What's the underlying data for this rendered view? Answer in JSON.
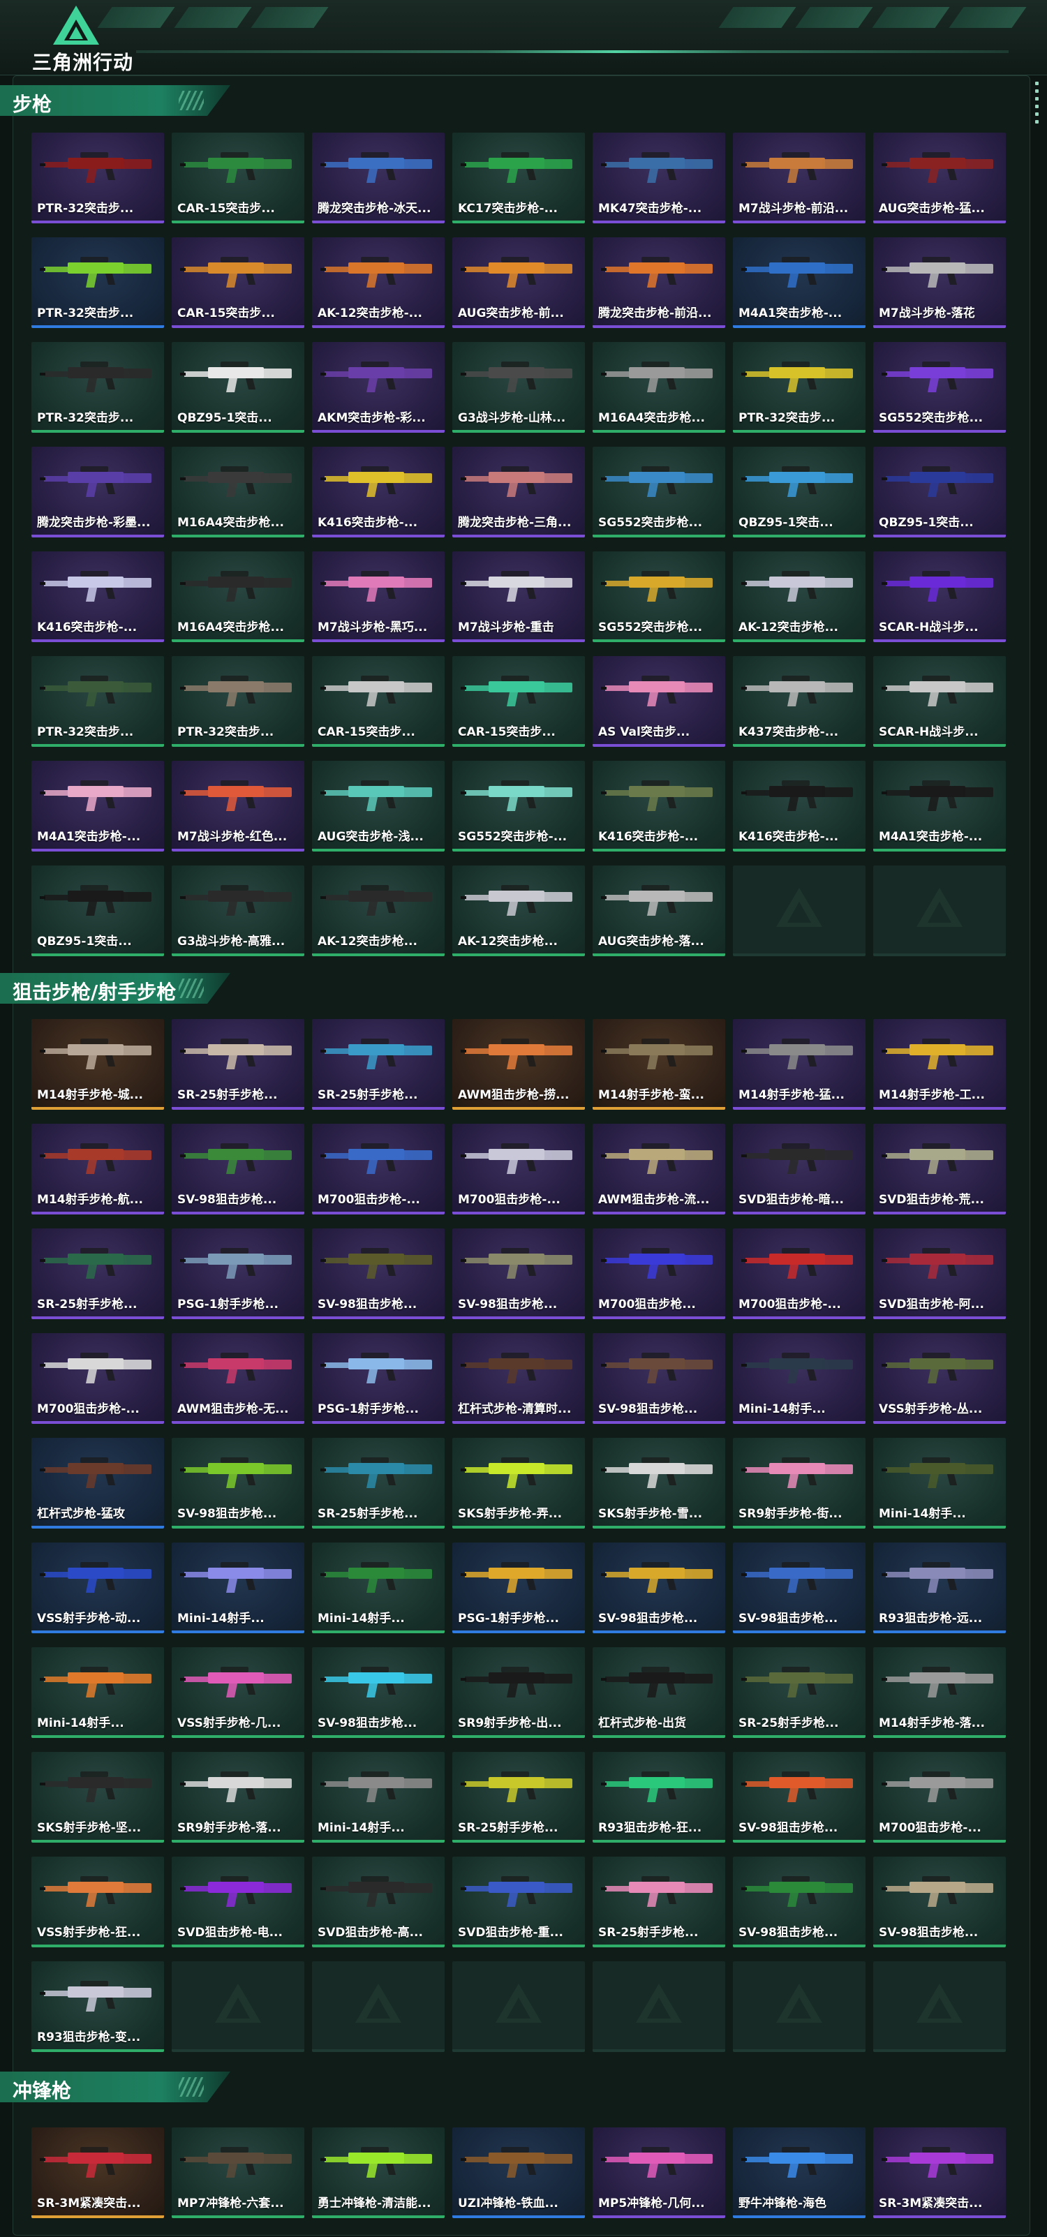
{
  "app": {
    "logo_text": "三角洲行动"
  },
  "sections": [
    {
      "title": "步枪",
      "items": [
        {
          "label": "PTR-32突击步...",
          "rarity": "purple",
          "color": "#8b1c1c"
        },
        {
          "label": "CAR-15突击步...",
          "rarity": "green",
          "color": "#2c8a3e"
        },
        {
          "label": "腾龙突击步枪-冰天...",
          "rarity": "purple",
          "color": "#3b6fc2"
        },
        {
          "label": "KC17突击步枪-...",
          "rarity": "green",
          "color": "#2aa34a"
        },
        {
          "label": "MK47突击步枪-...",
          "rarity": "purple",
          "color": "#3a6ea8"
        },
        {
          "label": "M7战斗步枪-前沿...",
          "rarity": "purple",
          "color": "#c87b3a"
        },
        {
          "label": "AUG突击步枪-猛...",
          "rarity": "purple",
          "color": "#8a2222"
        },
        {
          "label": "PTR-32突击步...",
          "rarity": "blue",
          "color": "#7bd12e"
        },
        {
          "label": "CAR-15突击步...",
          "rarity": "purple",
          "color": "#d98a2a"
        },
        {
          "label": "AK-12突击步枪-...",
          "rarity": "purple",
          "color": "#d9762a"
        },
        {
          "label": "AUG突击步枪-前...",
          "rarity": "purple",
          "color": "#e08a2a"
        },
        {
          "label": "腾龙突击步枪-前沿...",
          "rarity": "purple",
          "color": "#e0762a"
        },
        {
          "label": "M4A1突击步枪-...",
          "rarity": "blue",
          "color": "#2f6fc8"
        },
        {
          "label": "M7战斗步枪-落花",
          "rarity": "purple",
          "color": "#b8b8b8"
        },
        {
          "label": "PTR-32突击步...",
          "rarity": "green",
          "color": "#2a2a2a"
        },
        {
          "label": "QBZ95-1突击...",
          "rarity": "green",
          "color": "#e8e8e8"
        },
        {
          "label": "AKM突击步枪-彩...",
          "rarity": "purple",
          "color": "#6a3ea8"
        },
        {
          "label": "G3战斗步枪-山林...",
          "rarity": "green",
          "color": "#4a4a4a"
        },
        {
          "label": "M16A4突击步枪...",
          "rarity": "green",
          "color": "#9a9a9a"
        },
        {
          "label": "PTR-32突击步...",
          "rarity": "green",
          "color": "#d8c22a"
        },
        {
          "label": "SG552突击步枪...",
          "rarity": "purple",
          "color": "#7a3ed8"
        },
        {
          "label": "腾龙突击步枪-彩墨...",
          "rarity": "purple",
          "color": "#5a3ea8"
        },
        {
          "label": "M16A4突击步枪...",
          "rarity": "green",
          "color": "#3a3a3a"
        },
        {
          "label": "K416突击步枪-...",
          "rarity": "purple",
          "color": "#e0c02a"
        },
        {
          "label": "腾龙突击步枪-三角...",
          "rarity": "purple",
          "color": "#c87a7a"
        },
        {
          "label": "SG552突击步枪...",
          "rarity": "green",
          "color": "#3a8ac8"
        },
        {
          "label": "QBZ95-1突击...",
          "rarity": "green",
          "color": "#3a9ad8"
        },
        {
          "label": "QBZ95-1突击...",
          "rarity": "purple",
          "color": "#2a3a9a"
        },
        {
          "label": "K416突击步枪-...",
          "rarity": "purple",
          "color": "#c8c8e8"
        },
        {
          "label": "M16A4突击步枪...",
          "rarity": "green",
          "color": "#2a2a2a"
        },
        {
          "label": "M7战斗步枪-黑巧...",
          "rarity": "purple",
          "color": "#e07ab8"
        },
        {
          "label": "M7战斗步枪-重击",
          "rarity": "purple",
          "color": "#d8d8e0"
        },
        {
          "label": "SG552突击步枪...",
          "rarity": "green",
          "color": "#d8a82a"
        },
        {
          "label": "AK-12突击步枪...",
          "rarity": "green",
          "color": "#c8c8d8"
        },
        {
          "label": "SCAR-H战斗步...",
          "rarity": "purple",
          "color": "#6a2ad8"
        },
        {
          "label": "PTR-32突击步...",
          "rarity": "green",
          "color": "#3a5a3a"
        },
        {
          "label": "PTR-32突击步...",
          "rarity": "green",
          "color": "#8a7a6a"
        },
        {
          "label": "CAR-15突击步...",
          "rarity": "green",
          "color": "#c8c8c8"
        },
        {
          "label": "CAR-15突击步...",
          "rarity": "green",
          "color": "#3ac89a"
        },
        {
          "label": "AS Val突击步...",
          "rarity": "purple",
          "color": "#e88ab8"
        },
        {
          "label": "K437突击步枪-...",
          "rarity": "green",
          "color": "#b8b8b8"
        },
        {
          "label": "SCAR-H战斗步...",
          "rarity": "green",
          "color": "#c8c8c8"
        },
        {
          "label": "M4A1突击步枪-...",
          "rarity": "purple",
          "color": "#e8a8c8"
        },
        {
          "label": "M7战斗步枪-红色...",
          "rarity": "purple",
          "color": "#e05a3a"
        },
        {
          "label": "AUG突击步枪-浅...",
          "rarity": "green",
          "color": "#5ac8b8"
        },
        {
          "label": "SG552突击步枪-...",
          "rarity": "green",
          "color": "#7ad8c8"
        },
        {
          "label": "K416突击步枪-...",
          "rarity": "green",
          "color": "#6a7a4a"
        },
        {
          "label": "K416突击步枪-...",
          "rarity": "green",
          "color": "#1a1a1a"
        },
        {
          "label": "M4A1突击步枪-...",
          "rarity": "green",
          "color": "#1a1a1a"
        },
        {
          "label": "QBZ95-1突击...",
          "rarity": "green",
          "color": "#1a1a1a"
        },
        {
          "label": "G3战斗步枪-高雅...",
          "rarity": "green",
          "color": "#2a2a2a"
        },
        {
          "label": "AK-12突击步枪...",
          "rarity": "green",
          "color": "#2a2a2a"
        },
        {
          "label": "AK-12突击步枪...",
          "rarity": "green",
          "color": "#c8c8d0"
        },
        {
          "label": "AUG突击步枪-落...",
          "rarity": "green",
          "color": "#b8b8b8"
        },
        {
          "label": "",
          "rarity": "empty",
          "color": ""
        },
        {
          "label": "",
          "rarity": "empty",
          "color": ""
        }
      ]
    },
    {
      "title": "狙击步枪/射手步枪",
      "items": [
        {
          "label": "M14射手步枪-城...",
          "rarity": "gold",
          "color": "#b8a898"
        },
        {
          "label": "SR-25射手步枪...",
          "rarity": "purple",
          "color": "#c8b8a8"
        },
        {
          "label": "SR-25射手步枪...",
          "rarity": "purple",
          "color": "#3a9ac8"
        },
        {
          "label": "AWM狙击步枪-捞...",
          "rarity": "gold",
          "color": "#e07a3a"
        },
        {
          "label": "M14射手步枪-蛮...",
          "rarity": "gold",
          "color": "#8a7a5a"
        },
        {
          "label": "M14射手步枪-猛...",
          "rarity": "purple",
          "color": "#8a8a8a"
        },
        {
          "label": "M14射手步枪-工...",
          "rarity": "purple",
          "color": "#e0b02a"
        },
        {
          "label": "M14射手步枪-航...",
          "rarity": "purple",
          "color": "#a83a2a"
        },
        {
          "label": "SV-98狙击步枪...",
          "rarity": "purple",
          "color": "#3a8a3a"
        },
        {
          "label": "M700狙击步枪-...",
          "rarity": "purple",
          "color": "#3a6ac8"
        },
        {
          "label": "M700狙击步枪-...",
          "rarity": "purple",
          "color": "#c8c8d8"
        },
        {
          "label": "AWM狙击步枪-流...",
          "rarity": "purple",
          "color": "#b8a87a"
        },
        {
          "label": "SVD狙击步枪-暗...",
          "rarity": "purple",
          "color": "#2a2a2a"
        },
        {
          "label": "SVD狙击步枪-荒...",
          "rarity": "purple",
          "color": "#a8a88a"
        },
        {
          "label": "SR-25射手步枪...",
          "rarity": "purple",
          "color": "#2a6a4a"
        },
        {
          "label": "PSG-1射手步枪...",
          "rarity": "purple",
          "color": "#7a9ab8"
        },
        {
          "label": "SV-98狙击步枪...",
          "rarity": "purple",
          "color": "#5a5a2a"
        },
        {
          "label": "SV-98狙击步枪...",
          "rarity": "purple",
          "color": "#8a8a6a"
        },
        {
          "label": "M700狙击步枪...",
          "rarity": "purple",
          "color": "#3a3ad8"
        },
        {
          "label": "M700狙击步枪-...",
          "rarity": "purple",
          "color": "#c82a2a"
        },
        {
          "label": "SVD狙击步枪-阿...",
          "rarity": "purple",
          "color": "#a82a3a"
        },
        {
          "label": "M700狙击步枪-...",
          "rarity": "purple",
          "color": "#d8d8d8"
        },
        {
          "label": "AWM狙击步枪-无...",
          "rarity": "purple",
          "color": "#c83a6a"
        },
        {
          "label": "PSG-1射手步枪...",
          "rarity": "purple",
          "color": "#8ab8e8"
        },
        {
          "label": "杠杆式步枪-清算时...",
          "rarity": "purple",
          "color": "#5a3a2a"
        },
        {
          "label": "SV-98狙击步枪...",
          "rarity": "purple",
          "color": "#6a4a3a"
        },
        {
          "label": "Mini-14射手...",
          "rarity": "purple",
          "color": "#2a3a4a"
        },
        {
          "label": "VSS射手步枪-丛...",
          "rarity": "purple",
          "color": "#5a6a3a"
        },
        {
          "label": "杠杆式步枪-猛攻",
          "rarity": "blue",
          "color": "#6a3a2a"
        },
        {
          "label": "SV-98狙击步枪...",
          "rarity": "green",
          "color": "#7ac82a"
        },
        {
          "label": "SR-25射手步枪...",
          "rarity": "green",
          "color": "#2a8aa8"
        },
        {
          "label": "SKS射手步枪-弄...",
          "rarity": "green",
          "color": "#c8e82a"
        },
        {
          "label": "SKS射手步枪-雪...",
          "rarity": "green",
          "color": "#d8d8d8"
        },
        {
          "label": "SR9射手步枪-街...",
          "rarity": "green",
          "color": "#e88ab8"
        },
        {
          "label": "Mini-14射手...",
          "rarity": "green",
          "color": "#4a5a2a"
        },
        {
          "label": "VSS射手步枪-动...",
          "rarity": "blue",
          "color": "#2a4ac8"
        },
        {
          "label": "Mini-14射手...",
          "rarity": "blue",
          "color": "#8a8ae8"
        },
        {
          "label": "Mini-14射手...",
          "rarity": "green",
          "color": "#2a8a3a"
        },
        {
          "label": "PSG-1射手步枪...",
          "rarity": "blue",
          "color": "#e0a82a"
        },
        {
          "label": "SV-98狙击步枪...",
          "rarity": "blue",
          "color": "#d8a82a"
        },
        {
          "label": "SV-98狙击步枪...",
          "rarity": "blue",
          "color": "#3a6ac8"
        },
        {
          "label": "R93狙击步枪-远...",
          "rarity": "blue",
          "color": "#8a8ab8"
        },
        {
          "label": "Mini-14射手...",
          "rarity": "green",
          "color": "#e07a2a"
        },
        {
          "label": "VSS射手步枪-几...",
          "rarity": "green",
          "color": "#e05ab8"
        },
        {
          "label": "SV-98狙击步枪...",
          "rarity": "green",
          "color": "#3ac8e8"
        },
        {
          "label": "SR9射手步枪-出...",
          "rarity": "green",
          "color": "#1a1a1a"
        },
        {
          "label": "杠杆式步枪-出货",
          "rarity": "green",
          "color": "#1a1a1a"
        },
        {
          "label": "SR-25射手步枪...",
          "rarity": "green",
          "color": "#5a6a3a"
        },
        {
          "label": "M14射手步枪-落...",
          "rarity": "green",
          "color": "#9a9a9a"
        },
        {
          "label": "SKS射手步枪-坚...",
          "rarity": "green",
          "color": "#2a2a2a"
        },
        {
          "label": "SR9射手步枪-落...",
          "rarity": "green",
          "color": "#d8d8d8"
        },
        {
          "label": "Mini-14射手...",
          "rarity": "green",
          "color": "#8a8a8a"
        },
        {
          "label": "SR-25射手步枪...",
          "rarity": "green",
          "color": "#c8c82a"
        },
        {
          "label": "R93狙击步枪-狂...",
          "rarity": "green",
          "color": "#2ac87a"
        },
        {
          "label": "SV-98狙击步枪...",
          "rarity": "green",
          "color": "#e05a2a"
        },
        {
          "label": "M700狙击步枪-...",
          "rarity": "green",
          "color": "#9a9a9a"
        },
        {
          "label": "VSS射手步枪-狂...",
          "rarity": "green",
          "color": "#e07a3a"
        },
        {
          "label": "SVD狙击步枪-电...",
          "rarity": "green",
          "color": "#8a2ad8"
        },
        {
          "label": "SVD狙击步枪-高...",
          "rarity": "green",
          "color": "#2a2a2a"
        },
        {
          "label": "SVD狙击步枪-重...",
          "rarity": "green",
          "color": "#3a5ac8"
        },
        {
          "label": "SR-25射手步枪...",
          "rarity": "green",
          "color": "#e88ab8"
        },
        {
          "label": "SV-98狙击步枪...",
          "rarity": "green",
          "color": "#2a8a3a"
        },
        {
          "label": "SV-98狙击步枪...",
          "rarity": "green",
          "color": "#b8a88a"
        },
        {
          "label": "R93狙击步枪-变...",
          "rarity": "green",
          "color": "#c8c8d8"
        },
        {
          "label": "",
          "rarity": "empty",
          "color": ""
        },
        {
          "label": "",
          "rarity": "empty",
          "color": ""
        },
        {
          "label": "",
          "rarity": "empty",
          "color": ""
        },
        {
          "label": "",
          "rarity": "empty",
          "color": ""
        },
        {
          "label": "",
          "rarity": "empty",
          "color": ""
        },
        {
          "label": "",
          "rarity": "empty",
          "color": ""
        }
      ]
    },
    {
      "title": "冲锋枪",
      "items": [
        {
          "label": "SR-3M紧凑突击...",
          "rarity": "gold",
          "color": "#c82a3a"
        },
        {
          "label": "MP7冲锋枪-六套...",
          "rarity": "green",
          "color": "#5a4a3a"
        },
        {
          "label": "勇士冲锋枪-清洁能...",
          "rarity": "green",
          "color": "#9ae82a"
        },
        {
          "label": "UZI冲锋枪-铁血...",
          "rarity": "blue",
          "color": "#8a5a2a"
        },
        {
          "label": "MP5冲锋枪-几何...",
          "rarity": "purple",
          "color": "#e05ab8"
        },
        {
          "label": "野牛冲锋枪-海色",
          "rarity": "blue",
          "color": "#3a8ae8"
        },
        {
          "label": "SR-3M紧凑突击...",
          "rarity": "purple",
          "color": "#a83ad8"
        }
      ]
    }
  ]
}
